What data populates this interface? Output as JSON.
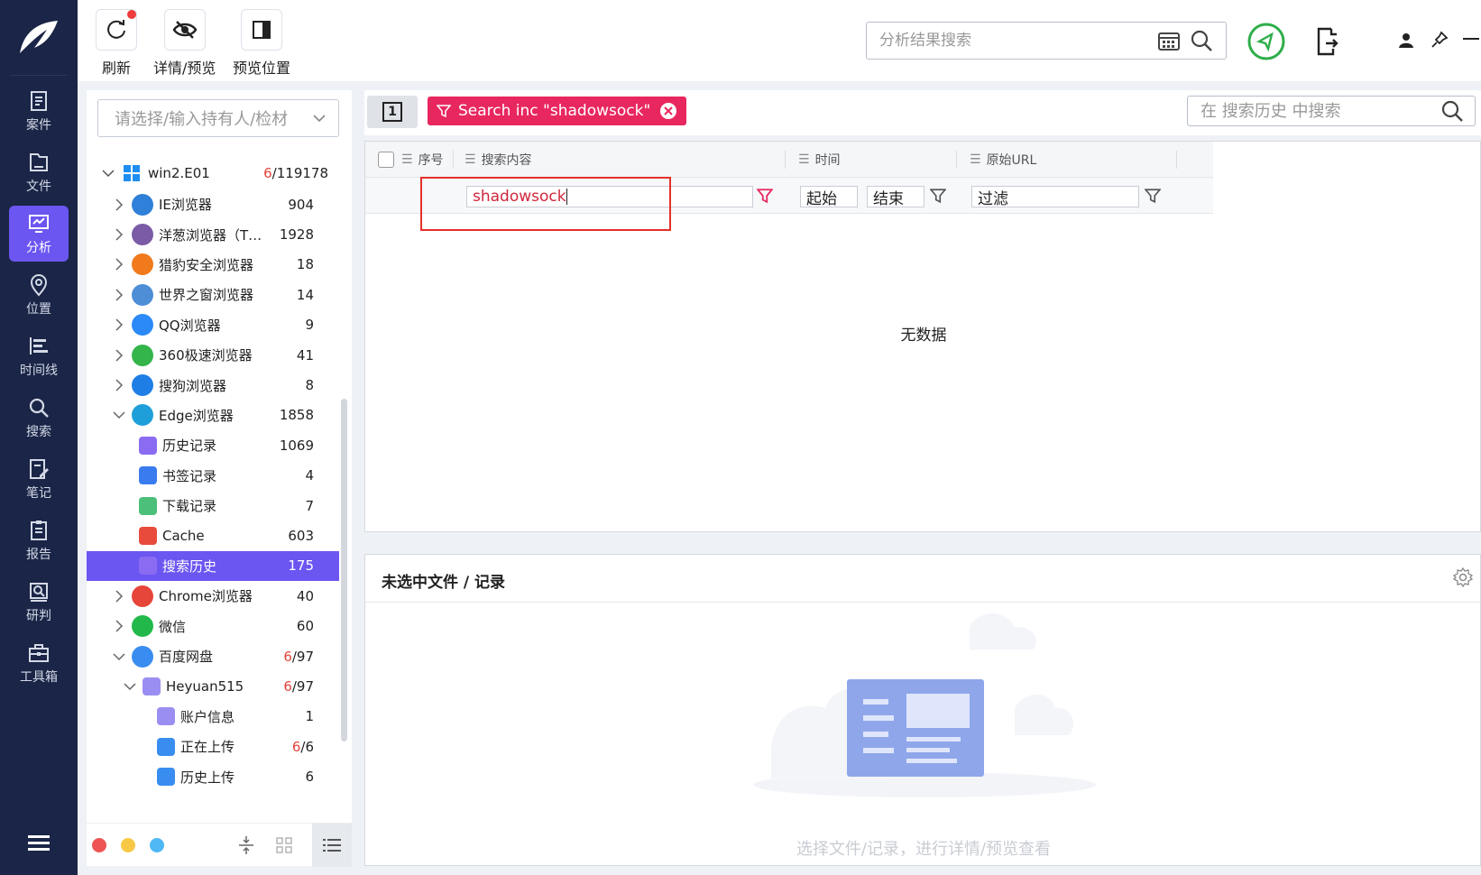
{
  "nav": {
    "items": [
      {
        "label": "案件",
        "icon": "case-icon"
      },
      {
        "label": "文件",
        "icon": "file-icon"
      },
      {
        "label": "分析",
        "icon": "analysis-icon",
        "active": true
      },
      {
        "label": "位置",
        "icon": "location-icon"
      },
      {
        "label": "时间线",
        "icon": "timeline-icon"
      },
      {
        "label": "搜索",
        "icon": "search-icon"
      },
      {
        "label": "笔记",
        "icon": "notes-icon"
      },
      {
        "label": "报告",
        "icon": "report-icon"
      },
      {
        "label": "研判",
        "icon": "judge-icon"
      },
      {
        "label": "工具箱",
        "icon": "toolbox-icon"
      }
    ]
  },
  "toolbar": {
    "refresh_label": "刷新",
    "details_label": "详情/预览",
    "preview_pos_label": "预览位置",
    "search_placeholder": "分析结果搜索"
  },
  "tree_panel": {
    "select_placeholder": "请选择/输入持有人/检材",
    "root": {
      "name": "win2.E01",
      "count_red": "6",
      "count": "/119178"
    },
    "items": [
      {
        "name": "IE浏览器",
        "count": "904",
        "level": 1,
        "expand": "right",
        "color": "#2f80d8",
        "icon": "ie-icon"
      },
      {
        "name": "洋葱浏览器（T…",
        "count": "1928",
        "level": 1,
        "expand": "right",
        "color": "#7b5ba6",
        "icon": "tor-icon"
      },
      {
        "name": "猎豹安全浏览器",
        "count": "18",
        "level": 1,
        "expand": "right",
        "color": "#f07a1c",
        "icon": "cheetah-icon"
      },
      {
        "name": "世界之窗浏览器",
        "count": "14",
        "level": 1,
        "expand": "right",
        "color": "#4d8ed6",
        "icon": "theworld-icon"
      },
      {
        "name": "QQ浏览器",
        "count": "9",
        "level": 1,
        "expand": "right",
        "color": "#2b8af7",
        "icon": "qq-browser-icon"
      },
      {
        "name": "360极速浏览器",
        "count": "41",
        "level": 1,
        "expand": "right",
        "color": "#33b54a",
        "icon": "360-icon"
      },
      {
        "name": "搜狗浏览器",
        "count": "8",
        "level": 1,
        "expand": "right",
        "color": "#1e7ee6",
        "icon": "sogou-icon"
      },
      {
        "name": "Edge浏览器",
        "count": "1858",
        "level": 1,
        "expand": "down",
        "color": "#1f9fd9",
        "icon": "edge-icon"
      },
      {
        "name": "历史记录",
        "count": "1069",
        "level": 2,
        "expand": "none",
        "color": "#8a6cf2",
        "icon": "history-icon"
      },
      {
        "name": "书签记录",
        "count": "4",
        "level": 2,
        "expand": "none",
        "color": "#3a7bf0",
        "icon": "bookmark-icon"
      },
      {
        "name": "下载记录",
        "count": "7",
        "level": 2,
        "expand": "none",
        "color": "#4cbf7a",
        "icon": "download-icon"
      },
      {
        "name": "Cache",
        "count": "603",
        "level": 2,
        "expand": "none",
        "color": "#e84b3c",
        "icon": "cache-icon"
      },
      {
        "name": "搜索历史",
        "count": "175",
        "level": 2,
        "expand": "none",
        "color": "#8a6cf2",
        "icon": "search-history-icon",
        "selected": true
      },
      {
        "name": "Chrome浏览器",
        "count": "40",
        "level": 1,
        "expand": "right",
        "color": "#e6453a",
        "icon": "chrome-icon"
      },
      {
        "name": "微信",
        "count": "60",
        "level": 1,
        "expand": "right",
        "color": "#22b94a",
        "icon": "wechat-icon"
      },
      {
        "name": "百度网盘",
        "count_red": "6",
        "count": "/97",
        "level": 1,
        "expand": "down",
        "color": "#3a8df0",
        "icon": "baidu-pan-icon"
      },
      {
        "name": "Heyuan515",
        "count_red": "6",
        "count": "/97",
        "level": 2,
        "expand": "down",
        "color": "#9b8ef2",
        "icon": "user-icon"
      },
      {
        "name": "账户信息",
        "count": "1",
        "level": 3,
        "expand": "none",
        "color": "#9b8ef2",
        "icon": "account-icon"
      },
      {
        "name": "正在上传",
        "count_red": "6",
        "count": "/6",
        "level": 3,
        "expand": "none",
        "color": "#3a8df0",
        "icon": "uploading-icon"
      },
      {
        "name": "历史上传",
        "count": "6",
        "level": 3,
        "expand": "none",
        "color": "#3a8df0",
        "icon": "upload-history-icon"
      }
    ],
    "footer_dots": [
      "#ee5454",
      "#f7c946",
      "#4fb8f5"
    ]
  },
  "tabs": {
    "tab_number": "1",
    "filter_tag": "Search inc \"shadowsock\"",
    "history_search_placeholder": "在 搜索历史 中搜索"
  },
  "grid": {
    "columns": [
      "序号",
      "搜索内容",
      "时间",
      "原始URL"
    ],
    "filter_values": {
      "content": "shadowsock",
      "start": "起始",
      "end": "结束",
      "url": "过滤"
    },
    "empty_text": "无数据"
  },
  "preview": {
    "title": "未选中文件 / 记录",
    "hint": "选择文件/记录，进行详情/预览查看"
  }
}
